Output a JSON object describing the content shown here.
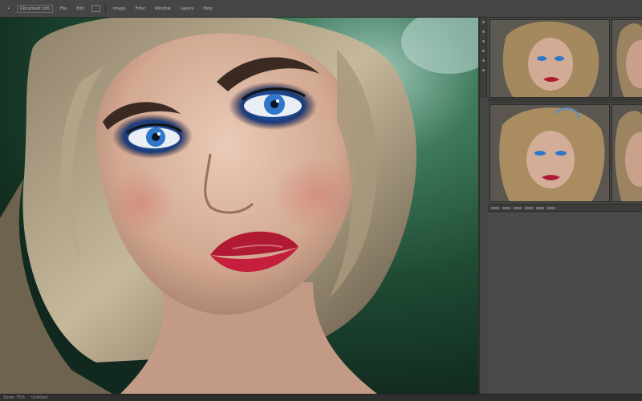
{
  "menubar": {
    "items": [
      "•",
      "Document info",
      "File",
      "Edit",
      "Image",
      "Filter",
      "Window",
      "Layers",
      "Help"
    ]
  },
  "status": {
    "left": "Zoom 75%",
    "right": "Untitled"
  },
  "colors": {
    "workspace": "#3a3a38",
    "panel": "#454544",
    "accent_lips": "#c51f3b",
    "accent_eyes": "#2f78c9"
  },
  "icons": [
    "tool-icon",
    "scroll-dot-icon"
  ]
}
